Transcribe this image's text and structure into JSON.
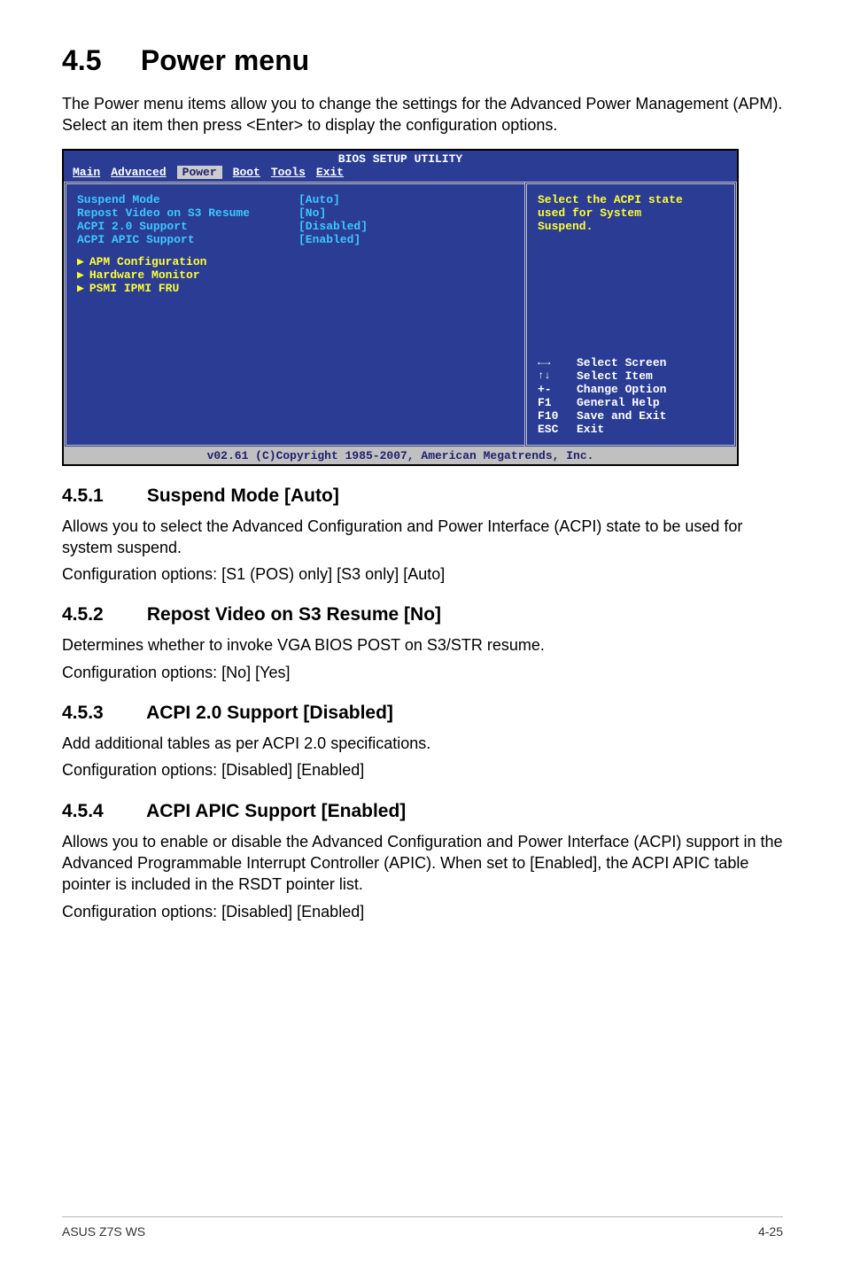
{
  "heading": {
    "number": "4.5",
    "title": "Power menu"
  },
  "intro": "The Power menu items allow you to change the settings for the Advanced Power Management (APM). Select an item then press <Enter> to display the configuration options.",
  "bios": {
    "title": "BIOS SETUP UTILITY",
    "tabs": [
      "Main",
      "Advanced",
      "Power",
      "Boot",
      "Tools",
      "Exit"
    ],
    "selected_tab": "Power",
    "items": [
      {
        "label": "Suspend Mode",
        "value": "[Auto]"
      },
      {
        "label": "Repost Video on S3 Resume",
        "value": "[No]"
      },
      {
        "label": "ACPI 2.0 Support",
        "value": "[Disabled]"
      },
      {
        "label": "ACPI APIC Support",
        "value": "[Enabled]"
      }
    ],
    "sub_items": [
      "APM Configuration",
      "Hardware Monitor",
      "PSMI IPMI FRU"
    ],
    "help_lines": [
      "Select the ACPI state",
      "used for System",
      "Suspend."
    ],
    "keys": [
      {
        "k": "←→",
        "v": "Select Screen"
      },
      {
        "k": "↑↓",
        "v": "Select Item"
      },
      {
        "k": "+-",
        "v": "Change Option"
      },
      {
        "k": "F1",
        "v": "General Help"
      },
      {
        "k": "F10",
        "v": "Save and Exit"
      },
      {
        "k": "ESC",
        "v": "Exit"
      }
    ],
    "footer": "v02.61 (C)Copyright 1985-2007, American Megatrends, Inc."
  },
  "subs": [
    {
      "num": "4.5.1",
      "title": "Suspend Mode [Auto]",
      "paras": [
        "Allows you to select the Advanced Configuration and Power Interface (ACPI) state to be used for system suspend.",
        "Configuration options: [S1 (POS) only] [S3 only] [Auto]"
      ]
    },
    {
      "num": "4.5.2",
      "title": "Repost Video on S3 Resume [No]",
      "paras": [
        "Determines whether to invoke VGA BIOS POST on S3/STR resume.",
        "Configuration options: [No] [Yes]"
      ]
    },
    {
      "num": "4.5.3",
      "title": "ACPI 2.0 Support [Disabled]",
      "paras": [
        "Add additional tables as per ACPI 2.0 specifications.",
        "Configuration options: [Disabled] [Enabled]"
      ]
    },
    {
      "num": "4.5.4",
      "title": "ACPI APIC Support [Enabled]",
      "paras": [
        "Allows you to enable or disable the Advanced Configuration and Power Interface (ACPI) support in the Advanced Programmable Interrupt Controller (APIC). When set to [Enabled], the ACPI APIC table pointer is included in the RSDT pointer list.",
        "Configuration options: [Disabled] [Enabled]"
      ]
    }
  ],
  "footer": {
    "left": "ASUS Z7S WS",
    "right": "4-25"
  }
}
